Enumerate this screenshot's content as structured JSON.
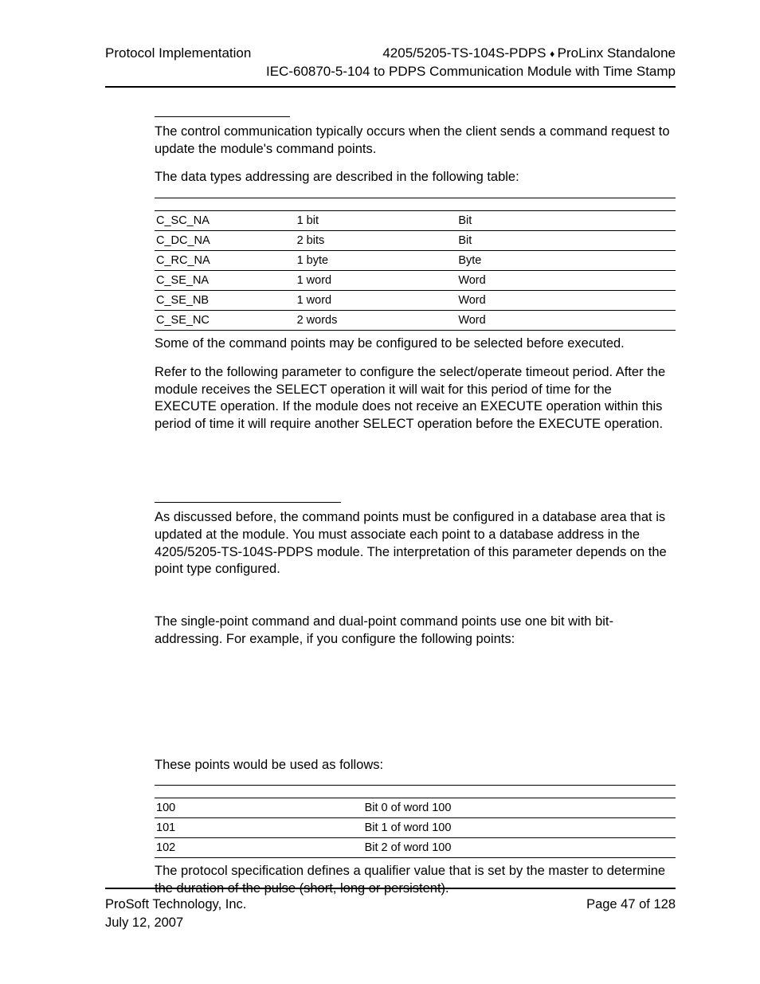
{
  "header": {
    "left": "Protocol Implementation",
    "right_line1_a": "4205/5205-TS-104S-PDPS",
    "right_line1_b": "ProLinx Standalone",
    "right_line2": "IEC-60870-5-104 to PDPS Communication Module with Time Stamp"
  },
  "para1": "The control communication typically occurs when the client sends a command request to update the module's command points.",
  "para2": "The data types addressing are described in the following table:",
  "table1": {
    "rows": [
      {
        "c1": "C_SC_NA",
        "c2": "1 bit",
        "c3": "Bit"
      },
      {
        "c1": "C_DC_NA",
        "c2": "2 bits",
        "c3": "Bit"
      },
      {
        "c1": "C_RC_NA",
        "c2": "1 byte",
        "c3": "Byte"
      },
      {
        "c1": "C_SE_NA",
        "c2": "1 word",
        "c3": "Word"
      },
      {
        "c1": "C_SE_NB",
        "c2": "1 word",
        "c3": "Word"
      },
      {
        "c1": "C_SE_NC",
        "c2": "2 words",
        "c3": "Word"
      }
    ]
  },
  "para3": "Some of the command points may be configured to be selected before executed.",
  "para4": "Refer to the following parameter to configure the select/operate timeout period. After the module receives the SELECT operation it will wait for this period of time for the EXECUTE operation. If the module does not receive an EXECUTE operation within this period of time it will require another SELECT operation before the EXECUTE operation.",
  "para5": "As discussed before, the command points must be configured in a database area that is updated at the module. You must associate each point to a database address in the 4205/5205-TS-104S-PDPS module. The interpretation of this parameter depends on the point type configured.",
  "para6": "The single-point command and dual-point command points use one bit with bit-addressing. For example, if you configure the following points:",
  "para7": "These points would be used as follows:",
  "table2": {
    "rows": [
      {
        "c1": "100",
        "c2": "Bit 0 of word 100"
      },
      {
        "c1": "101",
        "c2": "Bit 1 of word 100"
      },
      {
        "c1": "102",
        "c2": "Bit 2 of word 100"
      }
    ]
  },
  "para8": "The protocol specification defines a qualifier value that is set by the master to determine the duration of the pulse (short, long or persistent).",
  "footer": {
    "left_line1": "ProSoft Technology, Inc.",
    "left_line2": "July 12, 2007",
    "right": "Page 47 of 128"
  }
}
